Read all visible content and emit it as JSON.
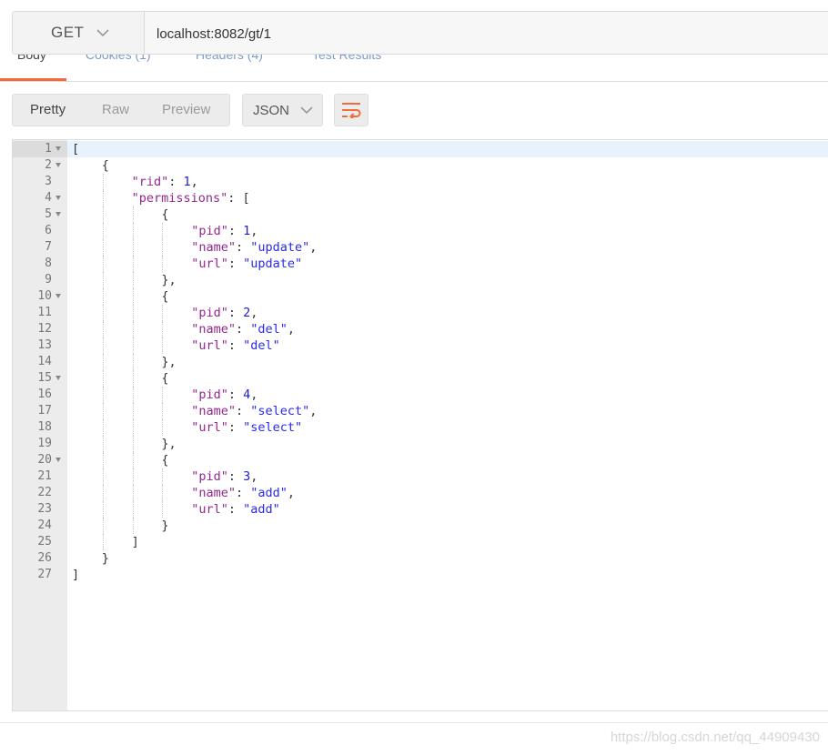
{
  "request": {
    "method": "GET",
    "url": "localhost:8082/gt/1"
  },
  "response_tabs": [
    {
      "label": "Body",
      "active": true
    },
    {
      "label": "Cookies (1)",
      "active": false
    },
    {
      "label": "Headers (4)",
      "active": false
    },
    {
      "label": "Test Results",
      "active": false
    }
  ],
  "toolbar": {
    "views": [
      "Pretty",
      "Raw",
      "Preview"
    ],
    "active_view": "Pretty",
    "format": "JSON",
    "wrap_icon": "wrap-lines-icon"
  },
  "colors": {
    "accent": "#f26b3a",
    "json_key": "#92278f",
    "json_value": "#2a2aea"
  },
  "editor": {
    "lines": [
      {
        "n": "1",
        "fold": true,
        "indent": 0,
        "parts": [
          [
            "p",
            "["
          ]
        ]
      },
      {
        "n": "2",
        "fold": true,
        "indent": 1,
        "parts": [
          [
            "p",
            "{"
          ]
        ]
      },
      {
        "n": "3",
        "fold": false,
        "indent": 2,
        "parts": [
          [
            "k",
            "\"rid\""
          ],
          [
            "p",
            ": "
          ],
          [
            "n",
            "1"
          ],
          [
            "p",
            ","
          ]
        ]
      },
      {
        "n": "4",
        "fold": true,
        "indent": 2,
        "parts": [
          [
            "k",
            "\"permissions\""
          ],
          [
            "p",
            ": ["
          ]
        ]
      },
      {
        "n": "5",
        "fold": true,
        "indent": 3,
        "parts": [
          [
            "p",
            "{"
          ]
        ]
      },
      {
        "n": "6",
        "fold": false,
        "indent": 4,
        "parts": [
          [
            "k",
            "\"pid\""
          ],
          [
            "p",
            ": "
          ],
          [
            "n",
            "1"
          ],
          [
            "p",
            ","
          ]
        ]
      },
      {
        "n": "7",
        "fold": false,
        "indent": 4,
        "parts": [
          [
            "k",
            "\"name\""
          ],
          [
            "p",
            ": "
          ],
          [
            "s",
            "\"update\""
          ],
          [
            "p",
            ","
          ]
        ]
      },
      {
        "n": "8",
        "fold": false,
        "indent": 4,
        "parts": [
          [
            "k",
            "\"url\""
          ],
          [
            "p",
            ": "
          ],
          [
            "s",
            "\"update\""
          ]
        ]
      },
      {
        "n": "9",
        "fold": false,
        "indent": 3,
        "parts": [
          [
            "p",
            "},"
          ]
        ]
      },
      {
        "n": "10",
        "fold": true,
        "indent": 3,
        "parts": [
          [
            "p",
            "{"
          ]
        ]
      },
      {
        "n": "11",
        "fold": false,
        "indent": 4,
        "parts": [
          [
            "k",
            "\"pid\""
          ],
          [
            "p",
            ": "
          ],
          [
            "n",
            "2"
          ],
          [
            "p",
            ","
          ]
        ]
      },
      {
        "n": "12",
        "fold": false,
        "indent": 4,
        "parts": [
          [
            "k",
            "\"name\""
          ],
          [
            "p",
            ": "
          ],
          [
            "s",
            "\"del\""
          ],
          [
            "p",
            ","
          ]
        ]
      },
      {
        "n": "13",
        "fold": false,
        "indent": 4,
        "parts": [
          [
            "k",
            "\"url\""
          ],
          [
            "p",
            ": "
          ],
          [
            "s",
            "\"del\""
          ]
        ]
      },
      {
        "n": "14",
        "fold": false,
        "indent": 3,
        "parts": [
          [
            "p",
            "},"
          ]
        ]
      },
      {
        "n": "15",
        "fold": true,
        "indent": 3,
        "parts": [
          [
            "p",
            "{"
          ]
        ]
      },
      {
        "n": "16",
        "fold": false,
        "indent": 4,
        "parts": [
          [
            "k",
            "\"pid\""
          ],
          [
            "p",
            ": "
          ],
          [
            "n",
            "4"
          ],
          [
            "p",
            ","
          ]
        ]
      },
      {
        "n": "17",
        "fold": false,
        "indent": 4,
        "parts": [
          [
            "k",
            "\"name\""
          ],
          [
            "p",
            ": "
          ],
          [
            "s",
            "\"select\""
          ],
          [
            "p",
            ","
          ]
        ]
      },
      {
        "n": "18",
        "fold": false,
        "indent": 4,
        "parts": [
          [
            "k",
            "\"url\""
          ],
          [
            "p",
            ": "
          ],
          [
            "s",
            "\"select\""
          ]
        ]
      },
      {
        "n": "19",
        "fold": false,
        "indent": 3,
        "parts": [
          [
            "p",
            "},"
          ]
        ]
      },
      {
        "n": "20",
        "fold": true,
        "indent": 3,
        "parts": [
          [
            "p",
            "{"
          ]
        ]
      },
      {
        "n": "21",
        "fold": false,
        "indent": 4,
        "parts": [
          [
            "k",
            "\"pid\""
          ],
          [
            "p",
            ": "
          ],
          [
            "n",
            "3"
          ],
          [
            "p",
            ","
          ]
        ]
      },
      {
        "n": "22",
        "fold": false,
        "indent": 4,
        "parts": [
          [
            "k",
            "\"name\""
          ],
          [
            "p",
            ": "
          ],
          [
            "s",
            "\"add\""
          ],
          [
            "p",
            ","
          ]
        ]
      },
      {
        "n": "23",
        "fold": false,
        "indent": 4,
        "parts": [
          [
            "k",
            "\"url\""
          ],
          [
            "p",
            ": "
          ],
          [
            "s",
            "\"add\""
          ]
        ]
      },
      {
        "n": "24",
        "fold": false,
        "indent": 3,
        "parts": [
          [
            "p",
            "}"
          ]
        ]
      },
      {
        "n": "25",
        "fold": false,
        "indent": 2,
        "parts": [
          [
            "p",
            "]"
          ]
        ]
      },
      {
        "n": "26",
        "fold": false,
        "indent": 1,
        "parts": [
          [
            "p",
            "}"
          ]
        ]
      },
      {
        "n": "27",
        "fold": false,
        "indent": 0,
        "parts": [
          [
            "p",
            "]"
          ]
        ]
      }
    ]
  },
  "watermark": "https://blog.csdn.net/qq_44909430"
}
